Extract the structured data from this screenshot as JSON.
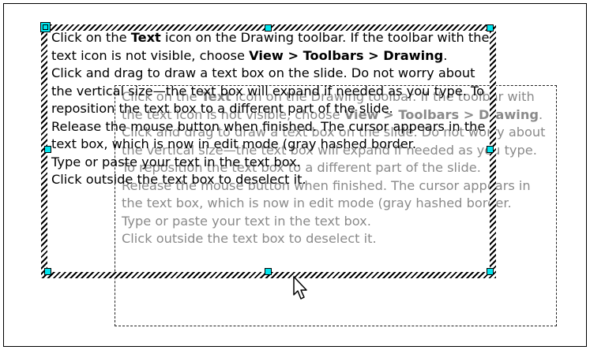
{
  "instructions": {
    "step1_pre": "Click on the ",
    "step1_icon_word": "Text",
    "step1_mid": " icon  on the Drawing toolbar. If the toolbar with the text icon is not visible, choose ",
    "step1_menu_path": "View > Toolbars > Drawing",
    "step1_end": ".",
    "step2": "Click and drag to draw a text box on the slide. Do not worry about the vertical size—the text box will expand if needed as you type. To reposition  the text box to a different part of the slide.",
    "step3": "Release the mouse button when finished. The cursor appears in the text box, which is now in edit mode (gray hashed border.",
    "step4": "Type or paste your text in the text box.",
    "step5": "Click outside the text box to deselect it."
  },
  "ghost": {
    "step1_pre": "Click on the ",
    "step1_icon_word": "Text",
    "step1_mid": " icon  on the Drawing toolbar. If the toolbar with the text icon is not visible, choose ",
    "step1_menu_path": "View > Toolbars > Drawing",
    "step1_end": ".",
    "step2": "Click and drag to draw a text box on the slide. Do not worry about the vertical size—the text box will expand if needed as you type. To reposition  the text box to a different part of the slide.",
    "step3": "Release the mouse button when finished. The cursor appears in the text box, which is now in edit mode (gray hashed border.",
    "step4": "Type or paste your text in the text box.",
    "step5": "Click outside the text box to deselect it."
  },
  "colors": {
    "handle": "#00e5ee",
    "ghost_text": "#8a8a8a",
    "hatch": "#000000"
  },
  "icons": {
    "cursor": "move-pointer-icon"
  }
}
